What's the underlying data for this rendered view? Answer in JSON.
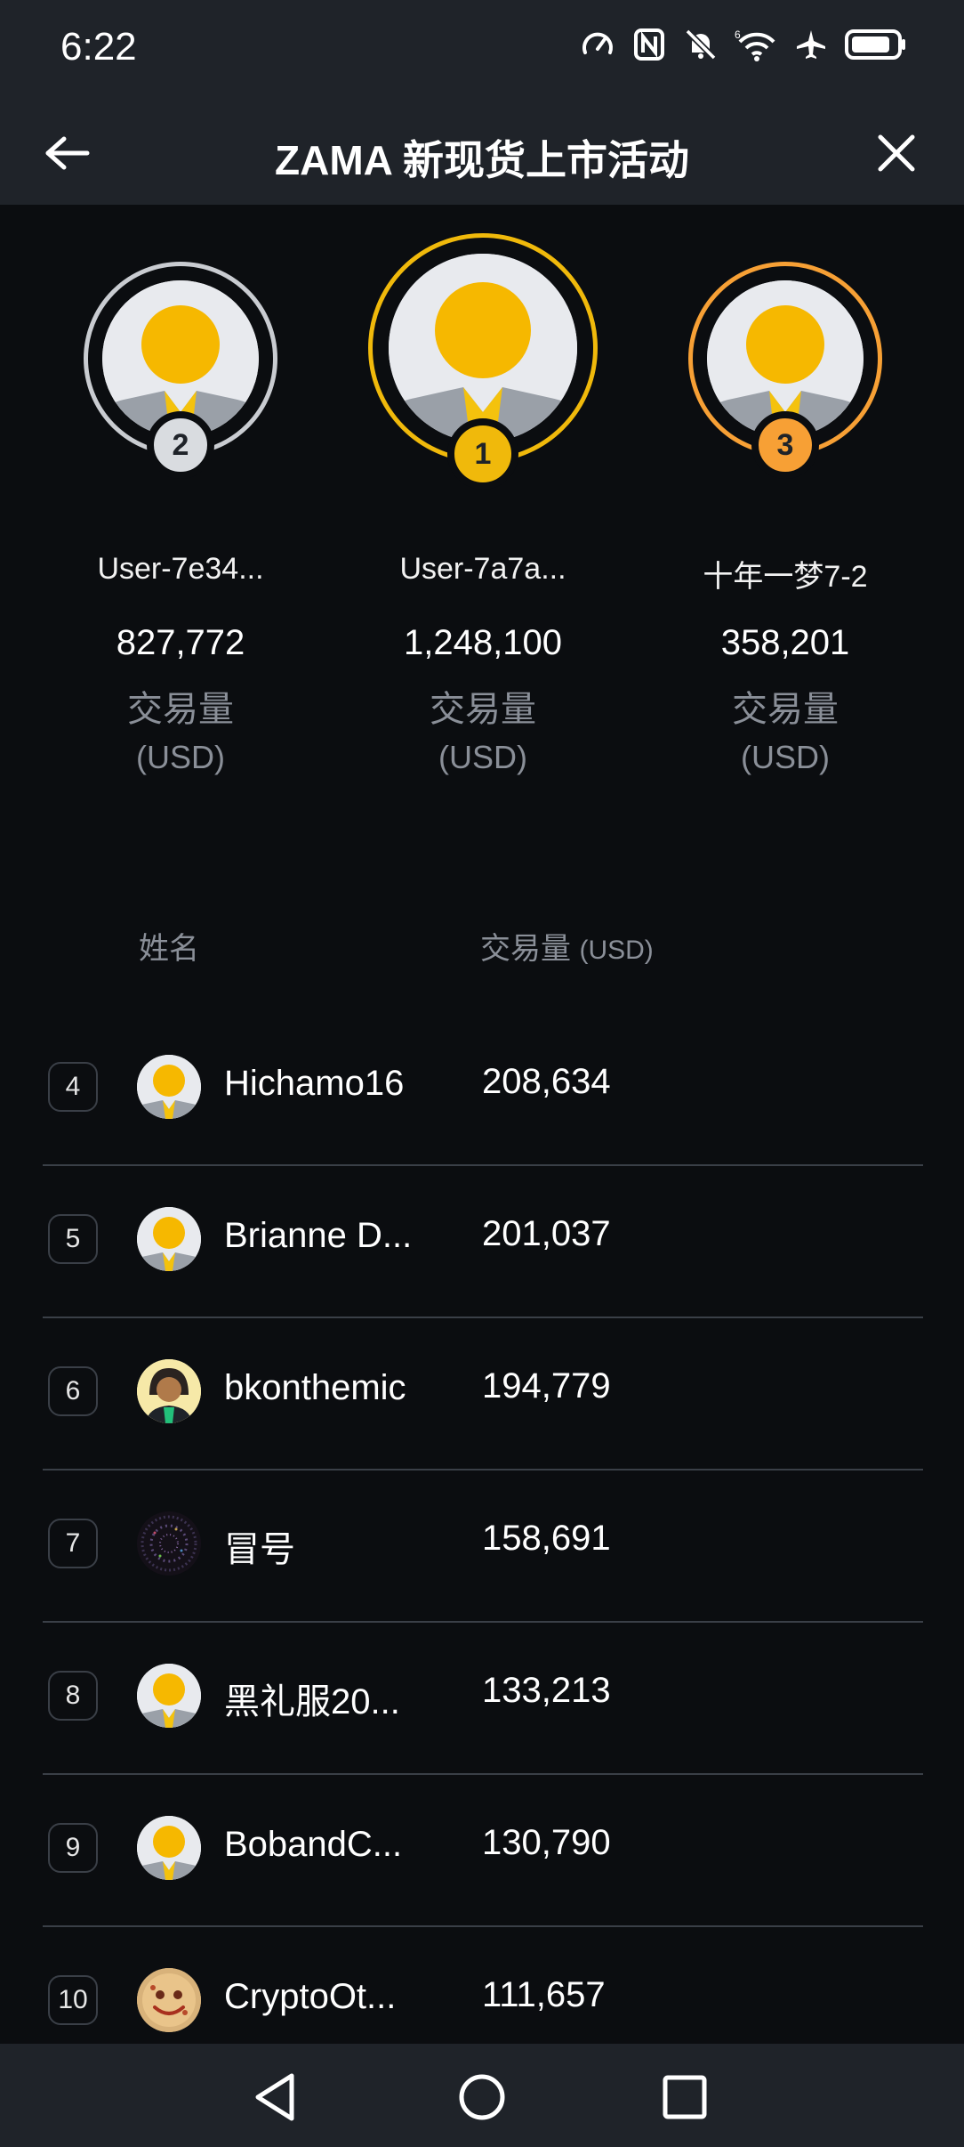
{
  "status_bar": {
    "time": "6:22",
    "icons": [
      "speedometer-icon",
      "nfc-icon",
      "mute-icon",
      "wifi-6-icon",
      "airplane-icon",
      "battery-icon"
    ]
  },
  "header": {
    "title": "ZAMA 新现货上市活动",
    "back_icon": "arrow-left-icon",
    "close_icon": "close-icon"
  },
  "podium": [
    {
      "rank": "2",
      "name": "User-7e34...",
      "volume": "827,772",
      "label": "交易量",
      "unit": "(USD)",
      "ring_color": "#c9ccd1"
    },
    {
      "rank": "1",
      "name": "User-7a7a...",
      "volume": "1,248,100",
      "label": "交易量",
      "unit": "(USD)",
      "ring_color": "#f0b90b"
    },
    {
      "rank": "3",
      "name": "十年一梦7-2",
      "volume": "358,201",
      "label": "交易量",
      "unit": "(USD)",
      "ring_color": "#f7a035"
    }
  ],
  "table": {
    "col_name": "姓名",
    "col_volume": "交易量",
    "col_volume_unit": "(USD)",
    "rows": [
      {
        "rank": "4",
        "name": "Hichamo16",
        "volume": "208,634",
        "avatar": "default"
      },
      {
        "rank": "5",
        "name": "Brianne D...",
        "volume": "201,037",
        "avatar": "default"
      },
      {
        "rank": "6",
        "name": "bkonthemic",
        "volume": "194,779",
        "avatar": "person"
      },
      {
        "rank": "7",
        "name": "冒号",
        "volume": "158,691",
        "avatar": "galaxy"
      },
      {
        "rank": "8",
        "name": "黑礼服20...",
        "volume": "133,213",
        "avatar": "default"
      },
      {
        "rank": "9",
        "name": "BobandC...",
        "volume": "130,790",
        "avatar": "default"
      },
      {
        "rank": "10",
        "name": "CryptoOt...",
        "volume": "111,657",
        "avatar": "smiley"
      }
    ]
  },
  "nav_bar": {
    "back": "nav-back-icon",
    "home": "nav-home-icon",
    "recents": "nav-recents-icon"
  },
  "colors": {
    "background": "#0b0d10",
    "bar": "#1f2329",
    "accent_gold": "#f0b90b",
    "silver": "#c9ccd1",
    "bronze": "#f7a035",
    "muted_text": "#8a8f98",
    "divider": "#3a3f47"
  }
}
